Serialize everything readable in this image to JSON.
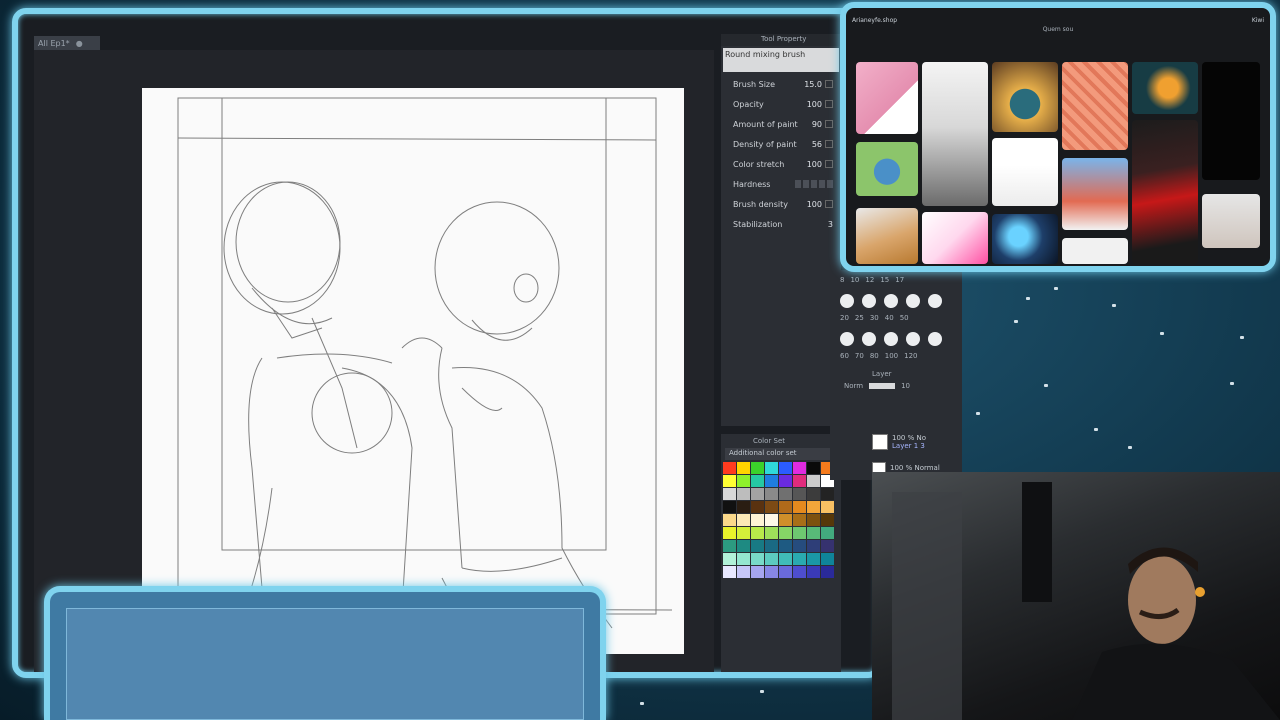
{
  "canvas": {
    "document_tab": "All Ep1*"
  },
  "tool_property": {
    "header": "Tool Property",
    "brush_name": "Round mixing brush",
    "rows": [
      {
        "label": "Brush Size",
        "value": "15.0"
      },
      {
        "label": "Opacity",
        "value": "100"
      },
      {
        "label": "Amount of paint",
        "value": "90"
      },
      {
        "label": "Density of paint",
        "value": "56"
      },
      {
        "label": "Color stretch",
        "value": "100"
      },
      {
        "label": "Hardness",
        "value": ""
      },
      {
        "label": "Brush density",
        "value": "100"
      },
      {
        "label": "Stabilization",
        "value": "3"
      }
    ]
  },
  "brush_sizes": [
    "8",
    "10",
    "12",
    "15",
    "17"
  ],
  "brush_sizes_row2": [
    "20",
    "25",
    "30",
    "40",
    "50"
  ],
  "brush_sizes_row3": [
    "60",
    "70",
    "80",
    "100",
    "120"
  ],
  "color_set": {
    "title": "Color Set",
    "selected": "Additional color set"
  },
  "layers": {
    "title": "Layer",
    "blend": "Norm",
    "opacity_value": "10",
    "items": [
      {
        "opacity": "100 % No",
        "name": "Layer 1 3"
      },
      {
        "opacity": "100 % Normal",
        "name": ""
      }
    ]
  },
  "browser": {
    "account": "Arianeyfe.shop",
    "board_label": "Quem sou",
    "right_label": "Kiwi"
  },
  "swatch_colors": [
    "#ff3b1f",
    "#ffd400",
    "#3bd22b",
    "#2fd9d9",
    "#2b5cff",
    "#e02be0",
    "#0a0a0a",
    "#f47a1c",
    "#ffff33",
    "#8ef02b",
    "#25c9a3",
    "#1f7de0",
    "#6a2be0",
    "#e02b7d",
    "#cccccc",
    "#ffffff",
    "#d8d8d8",
    "#bdbdbd",
    "#a3a3a3",
    "#8a8a8a",
    "#707070",
    "#565656",
    "#3c3c3c",
    "#232323",
    "#111111",
    "#2a1d12",
    "#5a3210",
    "#7d4a14",
    "#b06a1a",
    "#e58a1e",
    "#f3a63a",
    "#f8c063",
    "#fbd98a",
    "#fde9b6",
    "#fff3d6",
    "#fff8e8",
    "#cf8f2a",
    "#a86e17",
    "#7d510f",
    "#563709",
    "#e9f22b",
    "#d4f03a",
    "#b9ea4a",
    "#9fe05a",
    "#86d566",
    "#6ec870",
    "#58ba78",
    "#42aa7e",
    "#2c9a80",
    "#1e8a82",
    "#187a84",
    "#1a6a84",
    "#1e5a82",
    "#264c7e",
    "#2e3e78",
    "#36326f",
    "#b2f2d9",
    "#95e7d0",
    "#78dac8",
    "#5ccbc0",
    "#40bcb8",
    "#2aaab0",
    "#1a97a6",
    "#0f849a",
    "#e8e8ff",
    "#c6c6f8",
    "#a6a6ef",
    "#8787e5",
    "#6a6adb",
    "#4e4ecf",
    "#3a3ab8",
    "#2a2a9a"
  ]
}
